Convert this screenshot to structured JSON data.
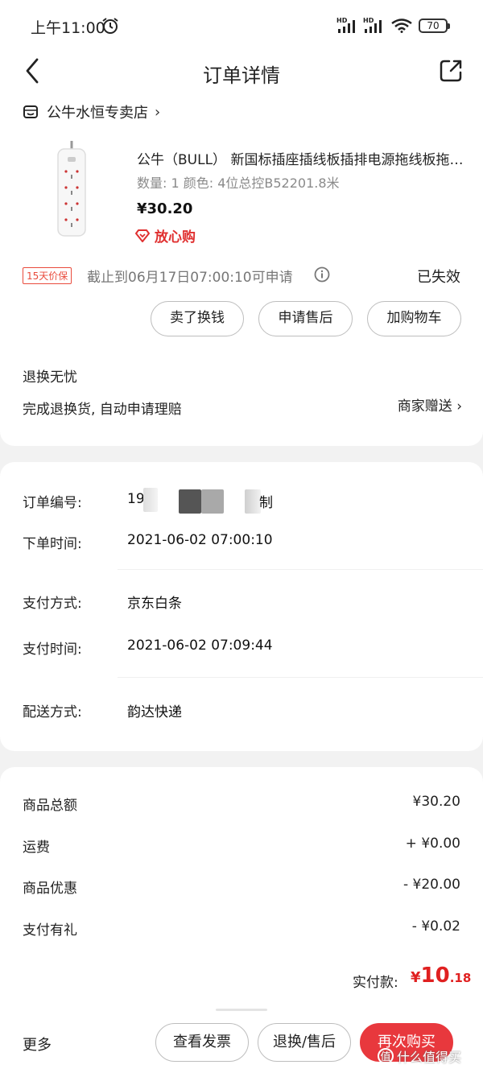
{
  "status_bar": {
    "time": "上午11:00",
    "hd1": "HD",
    "hd2": "HD",
    "battery": "70"
  },
  "header": {
    "title": "订单详情"
  },
  "store": {
    "name": "公牛水恒专卖店",
    "chevron": "›"
  },
  "product": {
    "title": "公牛（BULL） 新国标插座插线板插排电源拖线板拖线板",
    "spec": "数量: 1  颜色: 4位总控B52201.8米",
    "price": "¥30.20",
    "assurance": "放心购"
  },
  "price_protect": {
    "tag": "15天价保",
    "deadline": "截止到06月17日07:00:10可申请",
    "status": "已失效"
  },
  "actions": {
    "sell": "卖了换钱",
    "after_sale": "申请售后",
    "add_cart": "加购物车"
  },
  "refund": {
    "title": "退换无忧",
    "desc": "完成退换货, 自动申请理赔",
    "gift": "商家赠送 ›"
  },
  "order_info": {
    "number_label": "订单编号:",
    "number_prefix": "19",
    "number_suffix": "制",
    "time_label": "下单时间:",
    "time_value": "2021-06-02 07:00:10",
    "pay_method_label": "支付方式:",
    "pay_method_value": "京东白条",
    "pay_time_label": "支付时间:",
    "pay_time_value": "2021-06-02 07:09:44",
    "delivery_label": "配送方式:",
    "delivery_value": "韵达快递"
  },
  "amounts": {
    "total_label": "商品总额",
    "total_value": "¥30.20",
    "shipping_label": "运费",
    "shipping_value": "+ ¥0.00",
    "discount_label": "商品优惠",
    "discount_value": "- ¥20.00",
    "pay_gift_label": "支付有礼",
    "pay_gift_value": "- ¥0.02",
    "paid_label": "实付款:",
    "paid_currency": "¥",
    "paid_int": "10",
    "paid_dec": ".18"
  },
  "bottom_bar": {
    "more": "更多",
    "invoice": "查看发票",
    "return": "退换/售后",
    "rebuy": "再次购买"
  },
  "watermark": "什么值得买"
}
